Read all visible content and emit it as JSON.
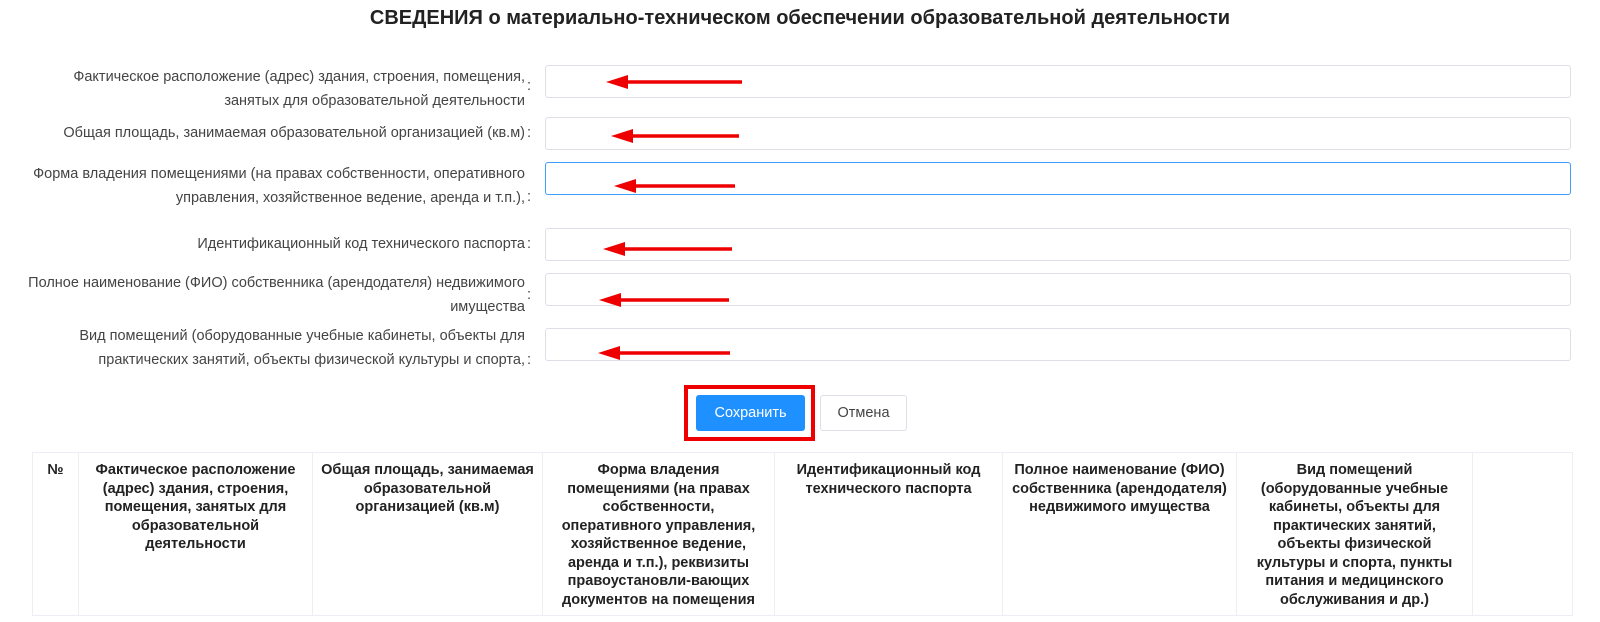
{
  "page": {
    "title": "СВЕДЕНИЯ о материально-техническом обеспечении образовательной деятельности"
  },
  "form": {
    "fields": [
      {
        "label": "Фактическое расположение (адрес) здания, строения, помещения, занятых для образовательной деятельности",
        "value": ""
      },
      {
        "label": "Общая площадь, занимаемая образовательной организацией (кв.м)",
        "value": ""
      },
      {
        "label": "Форма владения помещениями (на правах собственности, оперативного управления, хозяйственное ведение, аренда и т.п.),",
        "value": ""
      },
      {
        "label": "Идентификационный код технического паспорта",
        "value": ""
      },
      {
        "label": "Полное наименование (ФИО) собственника (арендодателя) недвижимого имущества",
        "value": ""
      },
      {
        "label": "Вид помещений (оборудованные учебные кабинеты, объекты для практических занятий, объекты физической культуры и спорта,",
        "value": ""
      }
    ],
    "colon": ":"
  },
  "actions": {
    "save_label": "Сохранить",
    "cancel_label": "Отмена"
  },
  "table": {
    "headers": [
      "№",
      "Фактическое расположение (адрес) здания, строения, помещения, занятых для образовательной деятельности",
      "Общая площадь, занимаемая образовательной организацией (кв.м)",
      "Форма владения помещениями (на правах собственности, оперативного управления, хозяйственное ведение, аренда и т.п.), реквизиты правоустановли-вающих документов на помещения",
      "Идентификационный код технического паспорта",
      "Полное наименование (ФИО) собственника (арендодателя) недвижимого имущества",
      "Вид помещений (оборудованные учебные кабинеты, объекты для практических занятий, объекты физической культуры и спорта, пункты питания и медицинского обслуживания и др.)",
      ""
    ]
  },
  "annotations": {
    "arrow_color": "#ee0000",
    "highlight_color": "#ee0000"
  },
  "colors": {
    "primary": "#1e90ff",
    "focus_border": "#409eff"
  }
}
